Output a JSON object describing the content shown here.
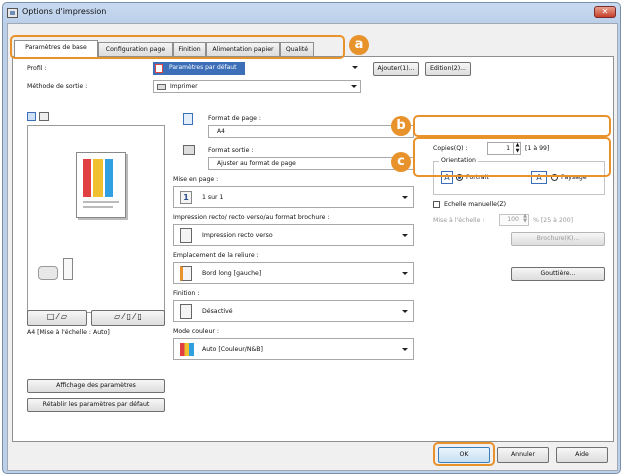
{
  "window": {
    "title": "Options d'impression",
    "close_label": "✕"
  },
  "tabs": [
    "Paramètres de base",
    "Configuration page",
    "Finition",
    "Alimentation papier",
    "Qualité"
  ],
  "profile": {
    "label": "Profil :",
    "value": "Paramètres par défaut",
    "add_button": "Ajouter(1)...",
    "edit_button": "Edition(2)..."
  },
  "output_method": {
    "label": "Méthode de sortie :",
    "value": "Imprimer"
  },
  "preview": {
    "status": "A4 [Mise à l'échelle : Auto]",
    "show_settings_button": "Affichage des paramètres",
    "restore_defaults_button": "Rétablir les paramètres par défaut"
  },
  "page_size": {
    "label": "Format de page :",
    "value": "A4"
  },
  "output_size": {
    "label": "Format sortie :",
    "value": "Ajuster au format de page"
  },
  "layout": {
    "label": "Mise en page :",
    "value": "1 sur 1",
    "icon_number": "1"
  },
  "duplex": {
    "label": "Impression recto/ recto verso/au format brochure :",
    "value": "Impression recto verso"
  },
  "binding": {
    "label": "Emplacement de la reliure :",
    "value": "Bord long [gauche]"
  },
  "finishing": {
    "label": "Finition :",
    "value": "Désactivé"
  },
  "color_mode": {
    "label": "Mode couleur :",
    "value": "Auto [Couleur/N&B]"
  },
  "copies": {
    "label": "Copies(Q) :",
    "value": "1",
    "range": "[1 à 99]"
  },
  "orientation": {
    "group_label": "Orientation",
    "portrait": "Portrait",
    "landscape": "Paysage",
    "icon_letter": "A"
  },
  "scaling": {
    "checkbox_label": "Echelle manuelle(Z)",
    "label": "Mise à l'échelle :",
    "value": "100",
    "range": "% [25 à 200]"
  },
  "booklet_button": "Brochure(K)...",
  "gutter_button": "Gouttière...",
  "footer": {
    "ok": "OK",
    "cancel": "Annuler",
    "help": "Aide"
  },
  "callouts": [
    "a",
    "b",
    "c"
  ],
  "accent_color": "#e8922c"
}
